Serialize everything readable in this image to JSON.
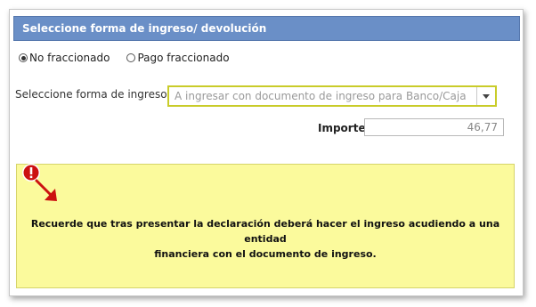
{
  "header": {
    "title": "Seleccione forma de ingreso/ devolución"
  },
  "payment_mode": {
    "options": [
      {
        "label": "No fraccionado",
        "selected": true
      },
      {
        "label": "Pago fraccionado",
        "selected": false
      }
    ]
  },
  "form": {
    "label": "Seleccione forma de ingreso:",
    "selected_value": "A ingresar con documento de ingreso para Banco/Caja"
  },
  "importe": {
    "label": "Importe",
    "value": "46,77"
  },
  "alert": {
    "icon": "exclamation-circle-icon",
    "line1": "Recuerde que tras presentar la declaración deberá hacer el ingreso acudiendo a una entidad",
    "line2": "financiera con el documento de ingreso."
  },
  "colors": {
    "header_bg": "#6a8fc7",
    "select_border": "#c9cc2a",
    "alert_bg": "#fbfa9c",
    "alert_icon": "#cc1111"
  }
}
